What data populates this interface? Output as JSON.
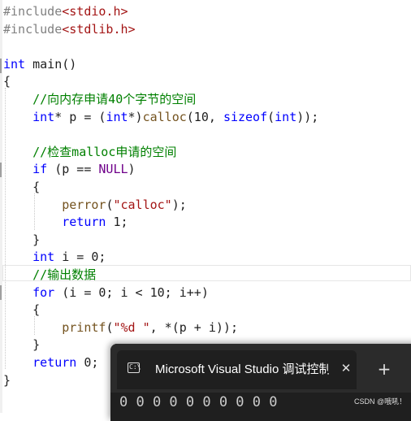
{
  "editor": {
    "code_lines": [
      {
        "parts": [
          {
            "t": "#include",
            "c": "pre"
          },
          {
            "t": "<stdio.h>",
            "c": "inc"
          }
        ]
      },
      {
        "parts": [
          {
            "t": "#include",
            "c": "pre"
          },
          {
            "t": "<stdlib.h>",
            "c": "inc"
          }
        ]
      },
      {
        "parts": []
      },
      {
        "parts": [
          {
            "t": "int",
            "c": "kw"
          },
          {
            "t": " main()",
            "c": "pl"
          }
        ]
      },
      {
        "parts": [
          {
            "t": "{",
            "c": "pl"
          }
        ]
      },
      {
        "parts": [
          {
            "t": "    //向内存申请40个字节的空间",
            "c": "com"
          }
        ]
      },
      {
        "parts": [
          {
            "t": "    ",
            "c": "pl"
          },
          {
            "t": "int",
            "c": "kw"
          },
          {
            "t": "* p = (",
            "c": "pl"
          },
          {
            "t": "int",
            "c": "kw"
          },
          {
            "t": "*)",
            "c": "pl"
          },
          {
            "t": "calloc",
            "c": "fn"
          },
          {
            "t": "(10, ",
            "c": "pl"
          },
          {
            "t": "sizeof",
            "c": "kw"
          },
          {
            "t": "(",
            "c": "pl"
          },
          {
            "t": "int",
            "c": "kw"
          },
          {
            "t": "));",
            "c": "pl"
          }
        ]
      },
      {
        "parts": []
      },
      {
        "parts": [
          {
            "t": "    //检查malloc申请的空间",
            "c": "com"
          }
        ]
      },
      {
        "parts": [
          {
            "t": "    ",
            "c": "pl"
          },
          {
            "t": "if",
            "c": "kw"
          },
          {
            "t": " (p == ",
            "c": "pl"
          },
          {
            "t": "NULL",
            "c": "null"
          },
          {
            "t": ")",
            "c": "pl"
          }
        ]
      },
      {
        "parts": [
          {
            "t": "    {",
            "c": "pl"
          }
        ]
      },
      {
        "parts": [
          {
            "t": "        ",
            "c": "pl"
          },
          {
            "t": "perror",
            "c": "fn"
          },
          {
            "t": "(",
            "c": "pl"
          },
          {
            "t": "\"calloc\"",
            "c": "str"
          },
          {
            "t": ");",
            "c": "pl"
          }
        ]
      },
      {
        "parts": [
          {
            "t": "        ",
            "c": "pl"
          },
          {
            "t": "return",
            "c": "kw"
          },
          {
            "t": " 1;",
            "c": "pl"
          }
        ]
      },
      {
        "parts": [
          {
            "t": "    }",
            "c": "pl"
          }
        ]
      },
      {
        "parts": [
          {
            "t": "    ",
            "c": "pl"
          },
          {
            "t": "int",
            "c": "kw"
          },
          {
            "t": " i = 0;",
            "c": "pl"
          }
        ]
      },
      {
        "parts": [
          {
            "t": "    //输出数据",
            "c": "com"
          }
        ]
      },
      {
        "parts": [
          {
            "t": "    ",
            "c": "pl"
          },
          {
            "t": "for",
            "c": "kw"
          },
          {
            "t": " (i = 0; i < 10; i++)",
            "c": "pl"
          }
        ]
      },
      {
        "parts": [
          {
            "t": "    {",
            "c": "pl"
          }
        ]
      },
      {
        "parts": [
          {
            "t": "        ",
            "c": "pl"
          },
          {
            "t": "printf",
            "c": "fn"
          },
          {
            "t": "(",
            "c": "pl"
          },
          {
            "t": "\"%d \"",
            "c": "str"
          },
          {
            "t": ", *(p + i));",
            "c": "pl"
          }
        ]
      },
      {
        "parts": [
          {
            "t": "    }",
            "c": "pl"
          }
        ]
      },
      {
        "parts": [
          {
            "t": "    ",
            "c": "pl"
          },
          {
            "t": "return",
            "c": "kw"
          },
          {
            "t": " 0;",
            "c": "pl"
          }
        ]
      },
      {
        "parts": [
          {
            "t": "}",
            "c": "pl"
          }
        ]
      }
    ]
  },
  "console": {
    "tab_title": "Microsoft Visual Studio 调试控制台",
    "tab_icon": "console-app-icon",
    "tab_icon_glyph": "C:\\",
    "close_glyph": "✕",
    "new_tab_glyph": "+",
    "output": "0 0 0 0 0 0 0 0 0 0"
  },
  "watermark": "CSDN @哦吼！",
  "colors": {
    "keyword": "#0000ff",
    "comment": "#008000",
    "string": "#a31515",
    "function": "#74531f",
    "preprocessor": "#808080",
    "macro": "#6f008a",
    "console_bg": "#1f1f1f"
  }
}
